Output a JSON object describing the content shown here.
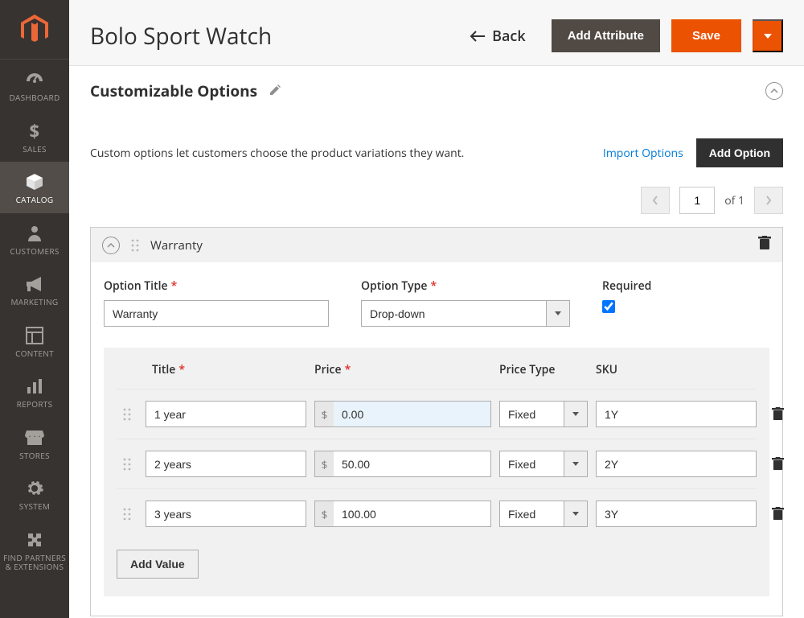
{
  "sidebar": {
    "items": [
      {
        "label": "DASHBOARD"
      },
      {
        "label": "SALES"
      },
      {
        "label": "CATALOG"
      },
      {
        "label": "CUSTOMERS"
      },
      {
        "label": "MARKETING"
      },
      {
        "label": "CONTENT"
      },
      {
        "label": "REPORTS"
      },
      {
        "label": "STORES"
      },
      {
        "label": "SYSTEM"
      },
      {
        "label": "FIND PARTNERS & EXTENSIONS"
      }
    ]
  },
  "header": {
    "title": "Bolo Sport Watch",
    "back_label": "Back",
    "add_attribute_label": "Add Attribute",
    "save_label": "Save"
  },
  "section": {
    "title": "Customizable Options",
    "intro": "Custom options let customers choose the product variations they want.",
    "import_label": "Import Options",
    "add_option_label": "Add Option"
  },
  "pager": {
    "current": "1",
    "of_label": "of 1"
  },
  "option": {
    "display_name": "Warranty",
    "title_label": "Option Title",
    "title_value": "Warranty",
    "type_label": "Option Type",
    "type_value": "Drop-down",
    "required_label": "Required"
  },
  "table": {
    "headers": {
      "title": "Title",
      "price": "Price",
      "price_type": "Price Type",
      "sku": "SKU"
    },
    "currency": "$",
    "rows": [
      {
        "title": "1 year",
        "price": "0.00",
        "price_type": "Fixed",
        "sku": "1Y",
        "highlight": true
      },
      {
        "title": "2 years",
        "price": "50.00",
        "price_type": "Fixed",
        "sku": "2Y",
        "highlight": false
      },
      {
        "title": "3 years",
        "price": "100.00",
        "price_type": "Fixed",
        "sku": "3Y",
        "highlight": false
      }
    ],
    "add_value_label": "Add Value"
  }
}
